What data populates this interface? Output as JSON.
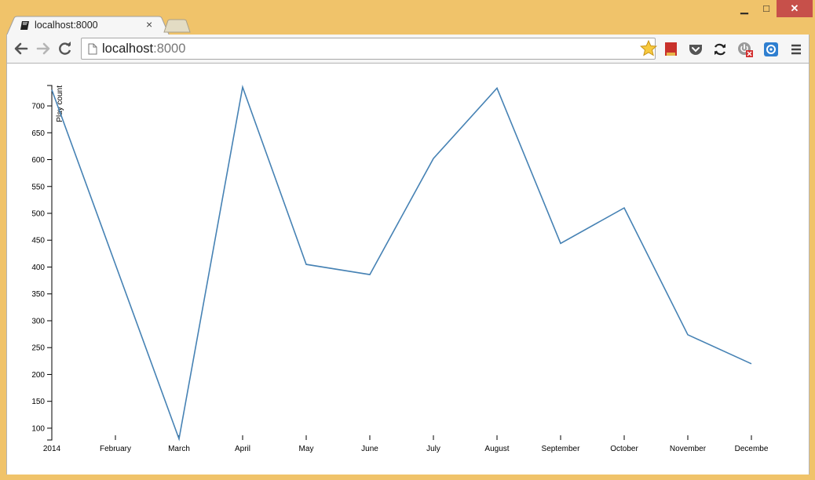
{
  "browser": {
    "tab": {
      "title": "localhost:8000",
      "close_glyph": "×"
    },
    "window": {
      "minimize_glyph": "▁",
      "maximize_glyph": "□",
      "close_glyph": "✕"
    },
    "address_bar": {
      "host": "localhost",
      "port": ":8000"
    },
    "icons": [
      "back-icon",
      "forward-icon",
      "reload-icon",
      "page-icon",
      "bookmark-star-icon",
      "extension-red-icon",
      "pocket-icon",
      "sync-icon",
      "power-extension-icon",
      "blue-extension-icon",
      "menu-icon"
    ],
    "colors": {
      "frame": "#f0c36a",
      "close_button": "#c7504a",
      "line": "#4682b4"
    }
  },
  "chart_data": {
    "type": "line",
    "title": "",
    "xlabel": "",
    "ylabel": "Play count",
    "ylim": [
      78,
      738
    ],
    "yticks": [
      100,
      150,
      200,
      250,
      300,
      350,
      400,
      450,
      500,
      550,
      600,
      650,
      700
    ],
    "categories": [
      "2014",
      "February",
      "March",
      "April",
      "May",
      "June",
      "July",
      "August",
      "September",
      "October",
      "November",
      "Decembe"
    ],
    "series": [
      {
        "values": [
          730,
          405,
          80,
          735,
          405,
          386,
          602,
          733,
          444,
          510,
          274,
          220
        ],
        "color": "#4682b4"
      }
    ],
    "grid": false,
    "legend": "none"
  }
}
